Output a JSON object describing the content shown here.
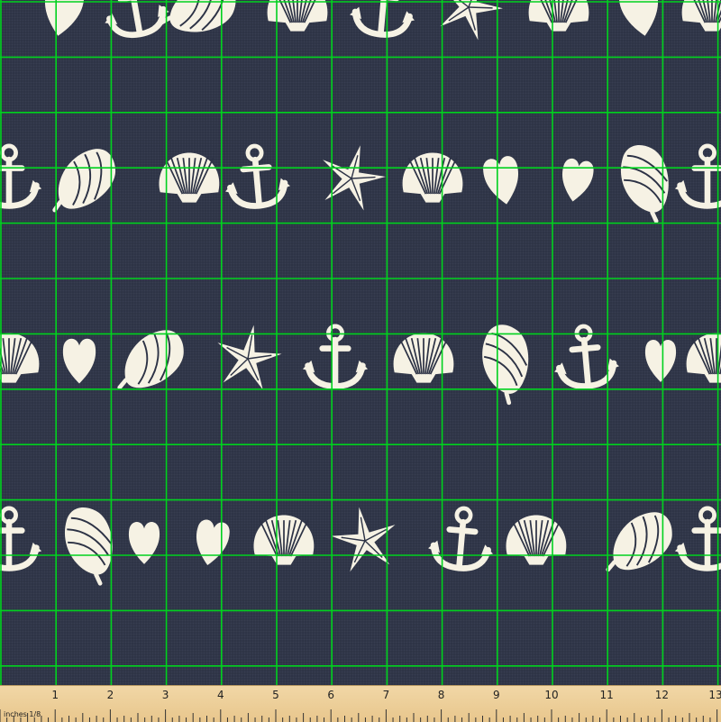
{
  "fabric": {
    "background_color": "#2c3245",
    "motif_color": "#f6f2e4",
    "grid_color": "#00d21e",
    "motif_sequence": [
      "anchor-icon",
      "conch-icon",
      "scallop-shell-icon",
      "starfish-icon",
      "heart-icon"
    ]
  },
  "ruler": {
    "unit_label": "inches 1/8",
    "numbers": [
      "1",
      "2",
      "3",
      "4",
      "5",
      "6",
      "7",
      "8",
      "9",
      "10",
      "11",
      "12",
      "13"
    ]
  }
}
